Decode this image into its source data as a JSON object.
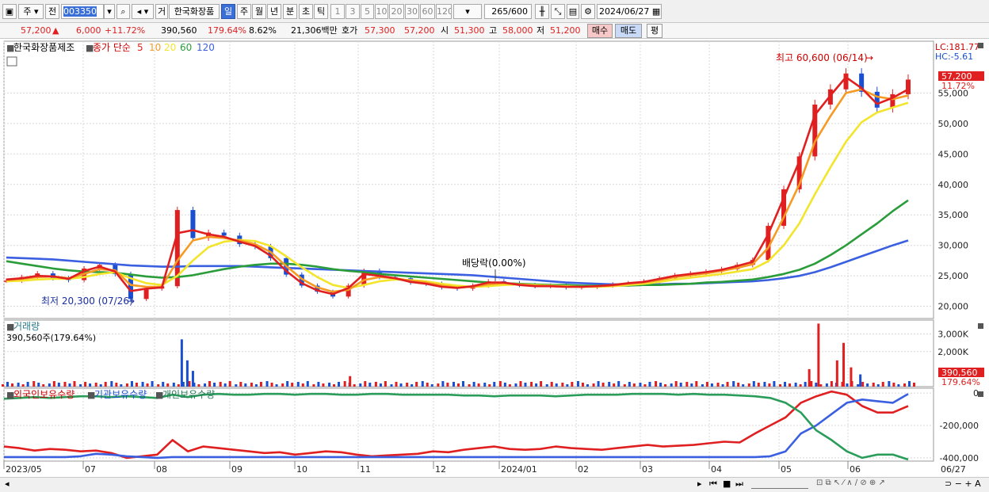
{
  "toolbar": {
    "market": "주",
    "mode": "전",
    "code": "003350",
    "name_btn": "거",
    "stock_name": "한국화장품",
    "periods": [
      "일",
      "주",
      "월",
      "년",
      "분",
      "초",
      "틱"
    ],
    "active_period": "일",
    "ticks": [
      "1",
      "3",
      "5",
      "10",
      "20",
      "30",
      "60",
      "120"
    ],
    "count": "265",
    "count_total": "/600",
    "date": "2024/06/27"
  },
  "info": {
    "price": "57,200",
    "change": "6,000",
    "change_pct": "+11.72%",
    "volume": "390,560",
    "volume_pct": "179.64%",
    "turnover": "8.62%",
    "amount": "21,306백만",
    "ask_label": "호가",
    "ask": "57,300",
    "bid": "57,200",
    "open_label": "시",
    "open": "51,300",
    "high_label": "고",
    "high": "58,000",
    "low_label": "저",
    "low": "51,200",
    "buy_btn": "매수",
    "sell_btn": "매도",
    "eval_btn": "평"
  },
  "colors": {
    "up": "#e02020",
    "down": "#1a4fd0",
    "ma5": "#e02020",
    "ma10": "#f59a23",
    "ma20": "#f2e52c",
    "ma60": "#2a9d3a",
    "ma120": "#3a5fe0",
    "foreign": "#e02020",
    "inst": "#3a5fe0",
    "indiv": "#2a9d5a"
  },
  "chart_data": [
    {
      "type": "line",
      "legend": {
        "name": "한국화장품제조",
        "ma_label": "종가 단순",
        "periods": [
          "5",
          "10",
          "20",
          "60",
          "120"
        ]
      },
      "x": [
        "2023/05",
        "07",
        "08",
        "09",
        "10",
        "11",
        "12",
        "2024/01",
        "02",
        "03",
        "04",
        "05",
        "06"
      ],
      "ylim": [
        18000,
        63500
      ],
      "yticks": [
        "20,000",
        "25,000",
        "30,000",
        "35,000",
        "40,000",
        "45,000",
        "50,000",
        "55,000"
      ],
      "current": {
        "price": "57,200",
        "pct": "11.72%"
      },
      "lc": "LC:181.77",
      "hc": "HC:-5.61",
      "annotations": {
        "high": "최고 60,600 (06/14)",
        "low": "최저 20,300 (07/26)",
        "dividend": "배당락(0.00%)"
      },
      "series": [
        {
          "name": "종가",
          "values": [
            24200,
            24800,
            25400,
            24600,
            24300,
            26200,
            26800,
            25300,
            21200,
            22900,
            23300,
            35800,
            31200,
            32100,
            31600,
            30200,
            29800,
            27900,
            25200,
            23400,
            22400,
            21600,
            23400,
            25800,
            24800,
            24600,
            23900,
            23700,
            23100,
            22900,
            23400,
            24100,
            23800,
            23500,
            23300,
            23400,
            23100,
            23200,
            23400,
            23600,
            23800,
            24100,
            24600,
            25100,
            25400,
            25700,
            26100,
            26800,
            27600,
            33200,
            39200,
            44600,
            53100,
            55600,
            58200,
            55200,
            52600,
            54800,
            57200
          ]
        },
        {
          "name": "5",
          "values": [
            24400,
            24600,
            25000,
            24900,
            24500,
            25800,
            26500,
            25700,
            22500,
            22900,
            23100,
            32000,
            32500,
            31800,
            31400,
            30600,
            29900,
            28300,
            25800,
            23800,
            22600,
            22000,
            23000,
            25300,
            25000,
            24600,
            24000,
            23700,
            23200,
            23000,
            23300,
            23900,
            23900,
            23500,
            23300,
            23300,
            23200,
            23200,
            23300,
            23500,
            23800,
            24000,
            24500,
            25000,
            25300,
            25600,
            26000,
            26600,
            27300,
            31800,
            37800,
            43800,
            51400,
            54600,
            57600,
            55800,
            53200,
            54200,
            55600
          ]
        },
        {
          "name": "10",
          "values": [
            24300,
            24500,
            24800,
            24900,
            24600,
            25300,
            26100,
            25900,
            23500,
            23200,
            23200,
            27500,
            30800,
            31400,
            31200,
            30800,
            30200,
            28900,
            26600,
            24500,
            23100,
            22400,
            22700,
            24300,
            24800,
            24600,
            24200,
            23900,
            23400,
            23100,
            23200,
            23600,
            23800,
            23600,
            23400,
            23300,
            23200,
            23200,
            23300,
            23400,
            23700,
            23900,
            24300,
            24800,
            25100,
            25400,
            25800,
            26300,
            26900,
            29600,
            34600,
            40000,
            47000,
            51200,
            55000,
            55600,
            54400,
            54000,
            54600
          ]
        },
        {
          "name": "20",
          "values": [
            24100,
            24200,
            24400,
            24500,
            24500,
            24800,
            25300,
            25600,
            24600,
            23800,
            23500,
            25000,
            27500,
            29700,
            30600,
            30900,
            30700,
            29900,
            28200,
            26400,
            24800,
            23500,
            23000,
            23500,
            24100,
            24400,
            24300,
            24100,
            23700,
            23400,
            23200,
            23300,
            23500,
            23600,
            23500,
            23400,
            23300,
            23200,
            23200,
            23300,
            23500,
            23700,
            24000,
            24400,
            24700,
            25000,
            25300,
            25700,
            26100,
            27400,
            30000,
            33600,
            38400,
            42800,
            47000,
            50200,
            51800,
            52600,
            53400
          ]
        },
        {
          "name": "60",
          "values": [
            27400,
            27000,
            26600,
            26200,
            25900,
            25700,
            25600,
            25500,
            25200,
            24900,
            24700,
            24800,
            25100,
            25600,
            26100,
            26500,
            26800,
            27000,
            27000,
            26800,
            26500,
            26100,
            25800,
            25600,
            25300,
            25100,
            24900,
            24700,
            24500,
            24300,
            24100,
            23900,
            23800,
            23700,
            23600,
            23500,
            23500,
            23400,
            23400,
            23400,
            23400,
            23500,
            23500,
            23600,
            23700,
            23900,
            24000,
            24200,
            24400,
            24800,
            25300,
            26000,
            27000,
            28400,
            30000,
            31800,
            33600,
            35600,
            37400
          ]
        },
        {
          "name": "120",
          "values": [
            28000,
            27900,
            27800,
            27700,
            27500,
            27300,
            27100,
            26900,
            26700,
            26600,
            26500,
            26500,
            26600,
            26600,
            26600,
            26600,
            26500,
            26400,
            26300,
            26200,
            26100,
            26000,
            25900,
            25800,
            25700,
            25600,
            25500,
            25400,
            25300,
            25200,
            25100,
            24900,
            24700,
            24500,
            24300,
            24100,
            23900,
            23800,
            23700,
            23600,
            23600,
            23600,
            23600,
            23700,
            23700,
            23800,
            23900,
            24000,
            24100,
            24300,
            24600,
            25000,
            25600,
            26400,
            27300,
            28200,
            29100,
            30000,
            30800
          ]
        }
      ]
    },
    {
      "type": "bar",
      "title": "거래량",
      "subtitle": "390,560주(179.64%)",
      "yticks": [
        "2,000K",
        "3,000K"
      ],
      "current": {
        "value": "390,560",
        "pct": "179.64%"
      },
      "spikes": [
        {
          "pos": 0.19,
          "value": 2700000,
          "color": "down"
        },
        {
          "pos": 0.196,
          "value": 1500000,
          "color": "down"
        },
        {
          "pos": 0.202,
          "value": 900000,
          "color": "down"
        },
        {
          "pos": 0.371,
          "value": 600000,
          "color": "up"
        },
        {
          "pos": 0.875,
          "value": 3600000,
          "color": "up"
        },
        {
          "pos": 0.865,
          "value": 1000000,
          "color": "up"
        },
        {
          "pos": 0.895,
          "value": 1500000,
          "color": "up"
        },
        {
          "pos": 0.902,
          "value": 2500000,
          "color": "up"
        },
        {
          "pos": 0.91,
          "value": 1100000,
          "color": "up"
        },
        {
          "pos": 0.92,
          "value": 700000,
          "color": "down"
        }
      ]
    },
    {
      "type": "line",
      "legend": [
        "외국인보유수량",
        "기관보유수량",
        "개인보유수량"
      ],
      "ylim": [
        -420000,
        30000
      ],
      "yticks": [
        "0",
        "-200,000",
        "-400,000"
      ],
      "series": [
        {
          "name": "외국인보유수량",
          "values": [
            -330000,
            -340000,
            -355000,
            -345000,
            -350000,
            -360000,
            -355000,
            -370000,
            -400000,
            -390000,
            -380000,
            -290000,
            -360000,
            -330000,
            -340000,
            -350000,
            -360000,
            -370000,
            -365000,
            -380000,
            -370000,
            -360000,
            -365000,
            -380000,
            -390000,
            -385000,
            -380000,
            -375000,
            -360000,
            -365000,
            -350000,
            -340000,
            -330000,
            -345000,
            -350000,
            -345000,
            -330000,
            -340000,
            -345000,
            -350000,
            -340000,
            -330000,
            -320000,
            -330000,
            -325000,
            -320000,
            -310000,
            -300000,
            -305000,
            -250000,
            -200000,
            -150000,
            -60000,
            -20000,
            10000,
            -10000,
            -80000,
            -120000,
            -120000,
            -80000
          ]
        },
        {
          "name": "기관보유수량",
          "values": [
            -395000,
            -395000,
            -395000,
            -395000,
            -395000,
            -390000,
            -375000,
            -380000,
            -390000,
            -395000,
            -400000,
            -395000,
            -395000,
            -395000,
            -395000,
            -395000,
            -395000,
            -395000,
            -395000,
            -395000,
            -395000,
            -395000,
            -395000,
            -395000,
            -395000,
            -395000,
            -395000,
            -395000,
            -395000,
            -395000,
            -395000,
            -395000,
            -395000,
            -395000,
            -395000,
            -395000,
            -395000,
            -395000,
            -395000,
            -395000,
            -395000,
            -395000,
            -395000,
            -395000,
            -395000,
            -395000,
            -395000,
            -395000,
            -395000,
            -395000,
            -390000,
            -360000,
            -250000,
            -200000,
            -130000,
            -60000,
            -40000,
            -50000,
            -60000,
            -5000
          ]
        },
        {
          "name": "개인보유수량",
          "values": [
            -35000,
            -30000,
            -25000,
            -30000,
            -25000,
            -20000,
            -20000,
            -25000,
            -20000,
            -25000,
            -30000,
            -10000,
            -25000,
            -10000,
            -5000,
            -10000,
            -10000,
            -5000,
            -5000,
            -10000,
            -5000,
            -5000,
            -10000,
            -10000,
            -5000,
            -5000,
            -10000,
            -10000,
            -10000,
            -10000,
            -15000,
            -15000,
            -20000,
            -15000,
            -15000,
            -15000,
            -20000,
            -15000,
            -10000,
            -10000,
            -10000,
            -5000,
            -5000,
            -5000,
            -10000,
            -5000,
            -10000,
            -10000,
            -15000,
            -20000,
            -30000,
            -60000,
            -120000,
            -230000,
            -290000,
            -360000,
            -400000,
            -380000,
            -380000,
            -410000
          ]
        }
      ]
    }
  ],
  "x_axis": {
    "labels": [
      "2023/05",
      "07",
      "08",
      "09",
      "10",
      "11",
      "12",
      "2024/01",
      "02",
      "03",
      "04",
      "05",
      "06"
    ],
    "end_label": "06/27"
  }
}
